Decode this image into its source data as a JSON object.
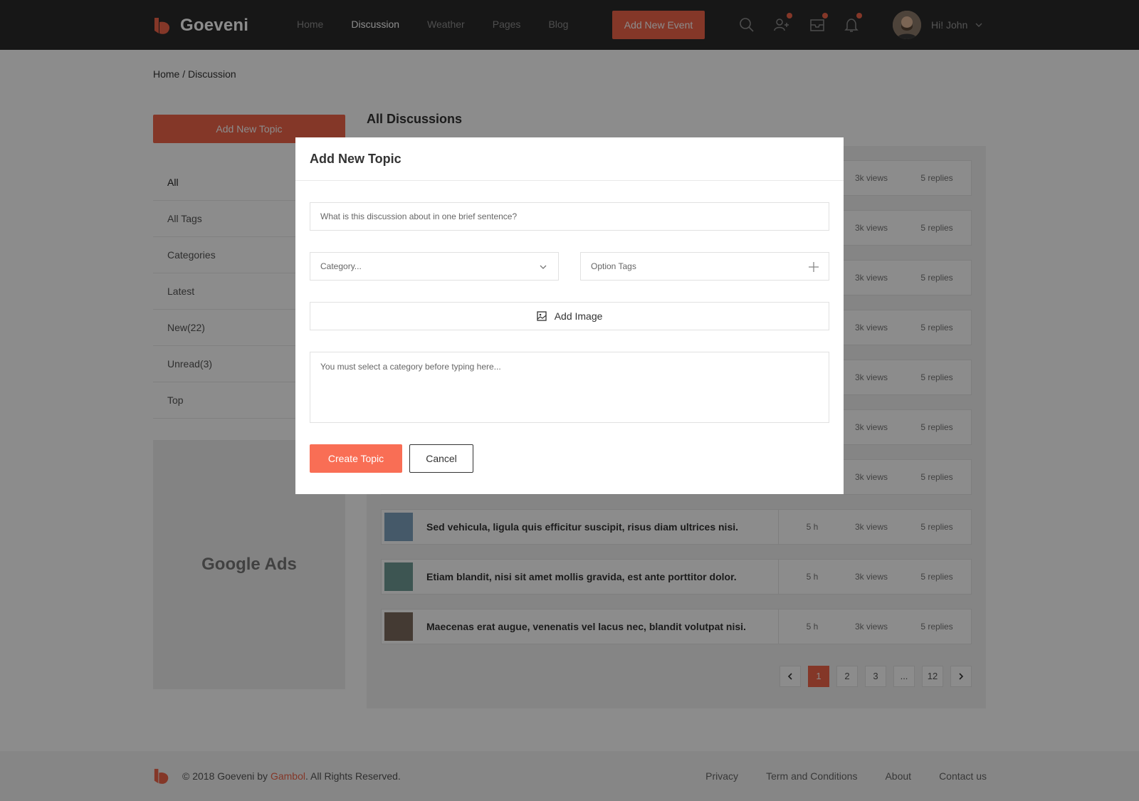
{
  "app": {
    "name": "Goeveni"
  },
  "nav": {
    "links": [
      {
        "label": "Home",
        "active": false
      },
      {
        "label": "Discussion",
        "active": true
      },
      {
        "label": "Weather",
        "active": false
      },
      {
        "label": "Pages",
        "active": false
      },
      {
        "label": "Blog",
        "active": false
      }
    ],
    "add_event_label": "Add New Event",
    "user_greeting": "Hi! John",
    "icons": [
      "search-icon",
      "friends-icon",
      "mail-icon",
      "bell-icon",
      "chevron-down-icon"
    ]
  },
  "breadcrumb": "Home / Discussion",
  "sidebar": {
    "add_topic_label": "Add New Topic",
    "items": [
      {
        "label": "All"
      },
      {
        "label": "All Tags"
      },
      {
        "label": "Categories"
      },
      {
        "label": "Latest"
      },
      {
        "label": "New(22)"
      },
      {
        "label": "Unread(3)"
      },
      {
        "label": "Top"
      }
    ],
    "ads_label": "Google Ads"
  },
  "main": {
    "title": "All Discussions",
    "topics": [
      {
        "title": "",
        "time": "",
        "views": "3k views",
        "replies": "5 replies"
      },
      {
        "title": "",
        "time": "",
        "views": "3k views",
        "replies": "5 replies"
      },
      {
        "title": "",
        "time": "",
        "views": "3k views",
        "replies": "5 replies"
      },
      {
        "title": "",
        "time": "",
        "views": "3k views",
        "replies": "5 replies"
      },
      {
        "title": "",
        "time": "",
        "views": "3k views",
        "replies": "5 replies"
      },
      {
        "title": "",
        "time": "",
        "views": "3k views",
        "replies": "5 replies"
      },
      {
        "title": "",
        "time": "",
        "views": "3k views",
        "replies": "5 replies"
      },
      {
        "title": "Sed vehicula, ligula quis efficitur suscipit, risus diam ultrices nisi.",
        "time": "5 h",
        "views": "3k views",
        "replies": "5 replies"
      },
      {
        "title": "Etiam blandit, nisi sit amet mollis gravida, est ante porttitor dolor.",
        "time": "5 h",
        "views": "3k views",
        "replies": "5 replies"
      },
      {
        "title": "Maecenas erat augue, venenatis vel lacus nec, blandit volutpat nisi.",
        "time": "5 h",
        "views": "3k views",
        "replies": "5 replies"
      }
    ],
    "pagination": {
      "pages": [
        "1",
        "2",
        "3",
        "...",
        "12"
      ],
      "current": "1"
    }
  },
  "modal": {
    "title": "Add New Topic",
    "topic_placeholder": "What is this discussion about in one brief sentence?",
    "category_placeholder": "Category...",
    "tags_placeholder": "Option Tags",
    "add_image_label": "Add Image",
    "body_placeholder": "You must select a category before typing here...",
    "create_label": "Create Topic",
    "cancel_label": "Cancel"
  },
  "footer": {
    "copyright_prefix": "© 2018 Goeveni by ",
    "copyright_brand": "Gambol",
    "copyright_suffix": ". All Rights Reserved.",
    "links": [
      "Privacy",
      "Term and Conditions",
      "About",
      "Contact us"
    ]
  },
  "colors": {
    "accent": "#f0644a",
    "nav_bg": "#2b2b2b"
  }
}
